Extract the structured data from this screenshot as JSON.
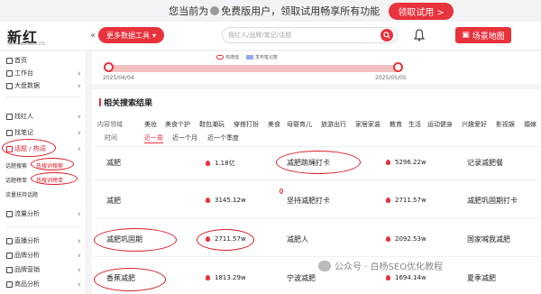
{
  "promo": {
    "text": "您当前为",
    "vip": "免费版用户，领取试用畅享所有功能",
    "button": "领取试用 >"
  },
  "header": {
    "logo": "新红",
    "logo_sub": "XIN HONGMEDIA LTD",
    "tools_button": "更多数据工具",
    "search_placeholder": "搜红人/品牌/笔记/话题",
    "map_button": "场景地图"
  },
  "sidebar": {
    "items": [
      {
        "label": "首页"
      },
      {
        "label": "工作台",
        "chevron": "∨"
      },
      {
        "label": "大盘数据",
        "chevron": "∨"
      },
      {
        "label": "找红人",
        "chevron": "∨"
      },
      {
        "label": "找笔记",
        "chevron": "∨"
      },
      {
        "label": "话题 / 热词",
        "chevron": "∧"
      },
      {
        "label": "流量分析",
        "chevron": "∨"
      },
      {
        "label": "直播分析",
        "chevron": "∨"
      },
      {
        "label": "品牌分析",
        "chevron": "∨"
      },
      {
        "label": "品牌营销",
        "chevron": "∨"
      },
      {
        "label": "商品分析",
        "chevron": "∨"
      }
    ],
    "subitems": [
      {
        "label": "话题搜索"
      },
      {
        "label": "热搜词搜索"
      },
      {
        "label": "话题榜单"
      },
      {
        "label": "热搜词榜单"
      },
      {
        "label": "流量扶持话题"
      }
    ]
  },
  "timeline": {
    "legend_a": "热搜值",
    "legend_b": "发布笔记数",
    "start_date": "2025/04/04",
    "end_date": "2025/05/05"
  },
  "panel": {
    "title": "相关搜索结果",
    "filter_label_1": "内容领域",
    "categories": [
      "美妆",
      "美食个护",
      "鞋包潮玩",
      "穿搭打扮",
      "美食",
      "母婴育儿",
      "旅游出行",
      "家居家装",
      "教育",
      "生活",
      "运动健身",
      "兴趣爱好",
      "影视娱",
      "婚嫁"
    ],
    "filter_label_2": "时间",
    "time_options": [
      "近一周",
      "近一个月",
      "近一个季度"
    ]
  },
  "results": [
    [
      {
        "name": "减肥",
        "value": "1.18亿"
      },
      {
        "name": "减肥跳绳打卡",
        "value": "5296.22w"
      },
      {
        "name": "记录减肥餐",
        "value": ""
      }
    ],
    [
      {
        "name": "减肥",
        "value": "3145.12w"
      },
      {
        "name": "坚持减肥打卡",
        "value": "2711.57w"
      },
      {
        "name": "减肥巩固期打卡",
        "value": ""
      }
    ],
    [
      {
        "name": "减肥巩固期",
        "value": "2711.57w"
      },
      {
        "name": "减肥人",
        "value": "2092.53w"
      },
      {
        "name": "国家喊我减肥",
        "value": ""
      }
    ],
    [
      {
        "name": "香蕉减肥",
        "value": "1813.29w"
      },
      {
        "name": "宁波减肥",
        "value": "1694.14w"
      },
      {
        "name": "夏季减肥",
        "value": ""
      }
    ]
  ],
  "watermark": "公众号 · 白杨SEO优化教程",
  "colors": {
    "accent": "#e8323c",
    "annotation": "#d81e2a"
  }
}
